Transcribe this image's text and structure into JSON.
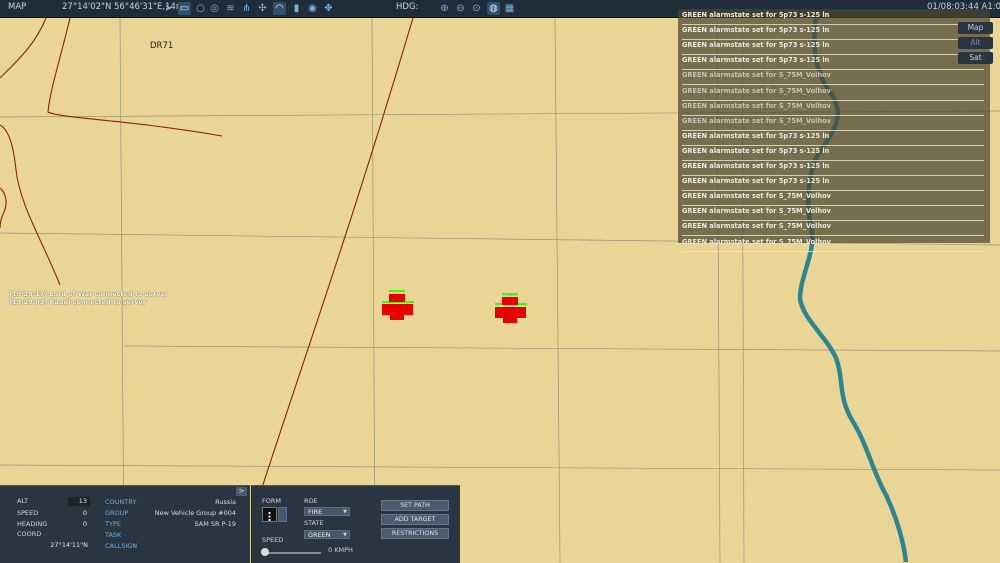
{
  "topbar": {
    "title": "MAP",
    "coords": "27°14'02\"N 56°46'31\"E,14m",
    "hdg_label": "HDG:",
    "clock": "01/08:03:44  A1:00",
    "icons_left": [
      "send-icon",
      "fuel-icon",
      "circle-icon",
      "layers-icon",
      "recon-icon",
      "network-icon",
      "target-icon",
      "wifi-icon",
      "pin-icon",
      "radar-icon",
      "move-icon"
    ],
    "icons_right": [
      "zoom-in-icon",
      "zoom-out-icon",
      "zoom-fit-icon",
      "globe-icon",
      "grid-icon"
    ]
  },
  "map": {
    "grid_label": "DR71",
    "view_buttons": [
      "Map",
      "Alt",
      "Sat"
    ],
    "selected_view": "Alt",
    "unit_color": "#e80000",
    "health_color": "#33ff00",
    "river_color": "#2d8590"
  },
  "messages": [
    "GREEN alarmstate set for 5p73 s-125 ln",
    "GREEN alarmstate set for 5p73 s-125 ln",
    "GREEN alarmstate set for 5p73 s-125 ln",
    "GREEN alarmstate set for 5p73 s-125 ln",
    "GREEN alarmstate set for S_75M_Volhov",
    "GREEN alarmstate set for S_75M_Volhov",
    "GREEN alarmstate set for S_75M_Volhov",
    "GREEN alarmstate set for S_75M_Volhov",
    "GREEN alarmstate set for 5p73 s-125 ln",
    "GREEN alarmstate set for 5p73 s-125 ln",
    "GREEN alarmstate set for 5p73 s-125 ln",
    "GREEN alarmstate set for 5p73 s-125 ln",
    "GREEN alarmstate set for S_75M_Volhov",
    "GREEN alarmstate set for S_75M_Volhov",
    "GREEN alarmstate set for S_75M_Volhov",
    "GREEN alarmstate set for S_75M_Volhov"
  ],
  "chat": [
    "[19:28:17] Lord of War connected to server",
    "[19:29:03] Raudi connected to server"
  ],
  "unit_info": {
    "alt_label": "ALT",
    "alt_value": "13",
    "speed_label": "SPEED",
    "speed_value": "0",
    "heading_label": "HEADING",
    "heading_value": "0",
    "coord_label": "COORD",
    "coord_value": "27°14'11\"N",
    "country_key": "COUNTRY",
    "country_value": "Russia",
    "group_key": "GROUP",
    "group_value": "New Vehicle Group #004",
    "type_key": "TYPE",
    "type_value": "SAM SR P-19",
    "task_key": "TASK",
    "callsign_key": "CALLSIGN",
    "collapse_label": ">"
  },
  "controls": {
    "form_label": "FORM",
    "roe_label": "ROE",
    "roe_value": "FIRE",
    "state_label": "STATE",
    "state_value": "GREEN",
    "speed_label": "SPEED",
    "speed_value": "0 KMPH",
    "set_path": "SET PATH",
    "add_target": "ADD TARGET",
    "restrictions": "RESTRICTIONS"
  }
}
